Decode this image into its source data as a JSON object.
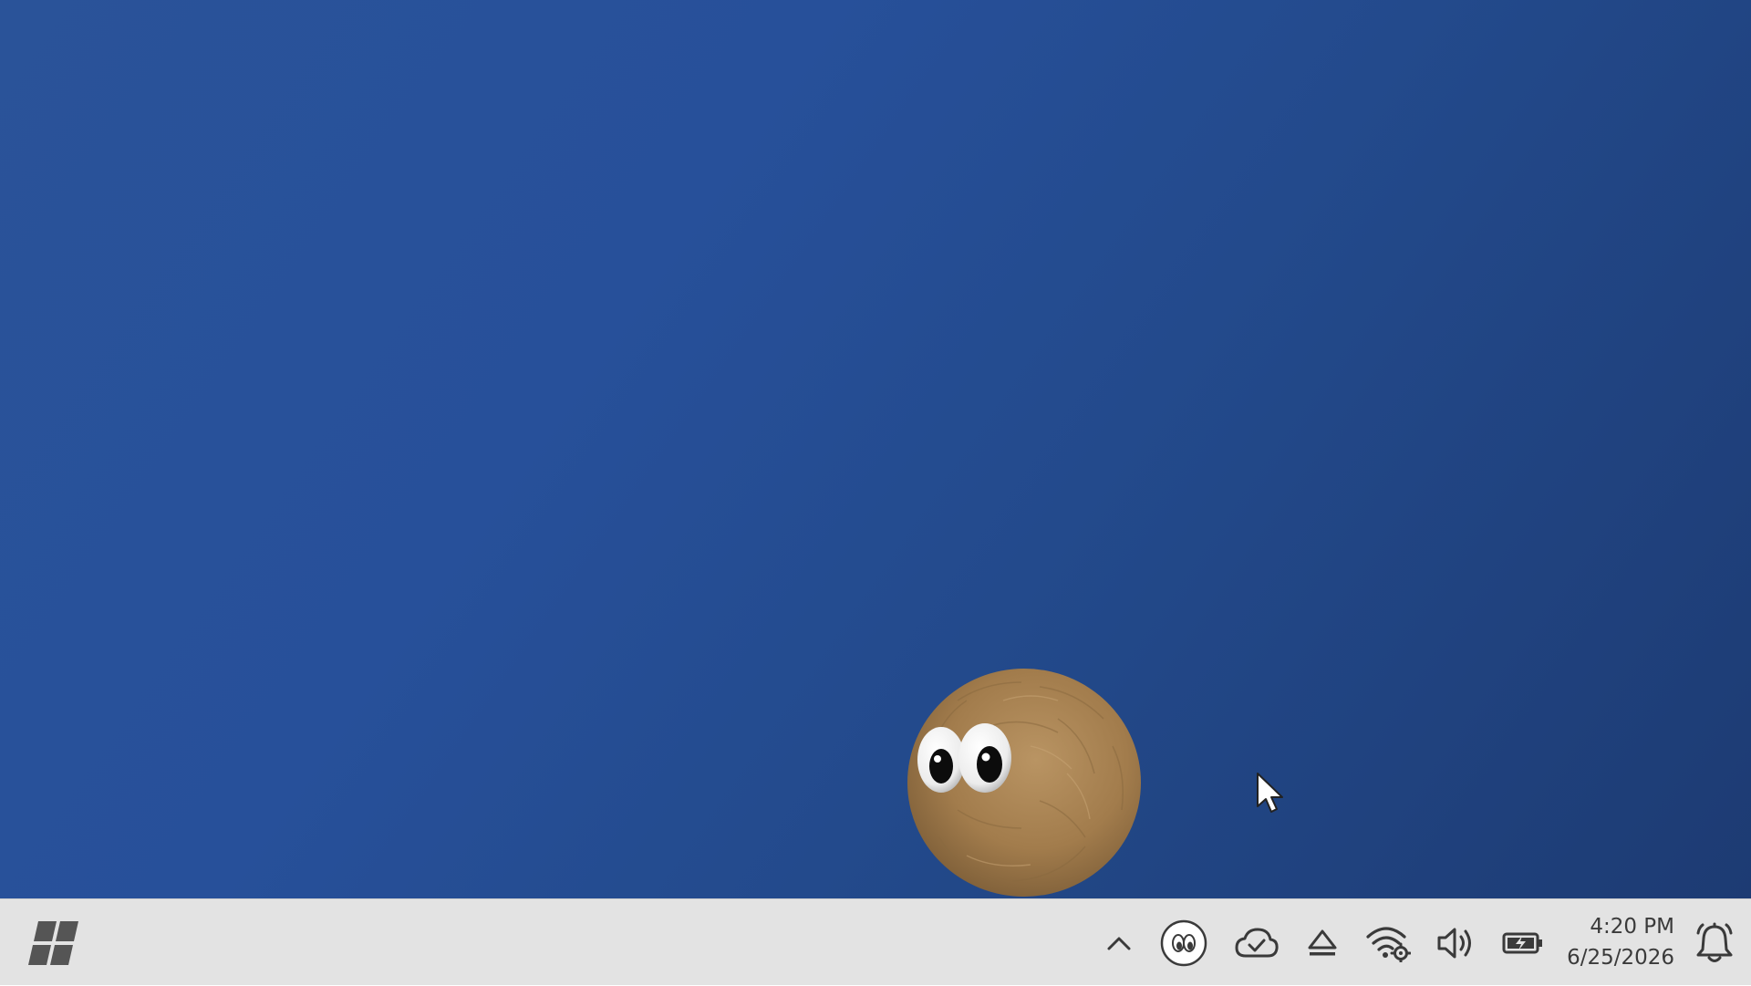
{
  "desktop": {
    "wallpaper_colors": [
      "#2a5399",
      "#234a8c",
      "#1d3b73"
    ],
    "pet": {
      "icon": "fuzzy-pet-icon",
      "fur_color": "#a5804f",
      "eye_color": "#ffffff"
    },
    "cursor": {
      "icon": "mouse-pointer-icon"
    }
  },
  "taskbar": {
    "background": "#e3e3e3",
    "start_button": {
      "icon": "start-menu-icon",
      "color": "#555555"
    },
    "tray": {
      "overflow": {
        "icon": "chevron-up-icon"
      },
      "pet_app": {
        "icon": "googly-eyes-icon"
      },
      "cloud_sync": {
        "icon": "cloud-check-icon"
      },
      "eject": {
        "icon": "eject-icon"
      },
      "wifi": {
        "icon": "wifi-settings-icon"
      },
      "volume": {
        "icon": "speaker-icon"
      },
      "battery": {
        "icon": "battery-charging-icon"
      },
      "notifications": {
        "icon": "bell-icon"
      }
    },
    "clock": {
      "time": "4:20 PM",
      "date": "6/25/2026"
    }
  }
}
